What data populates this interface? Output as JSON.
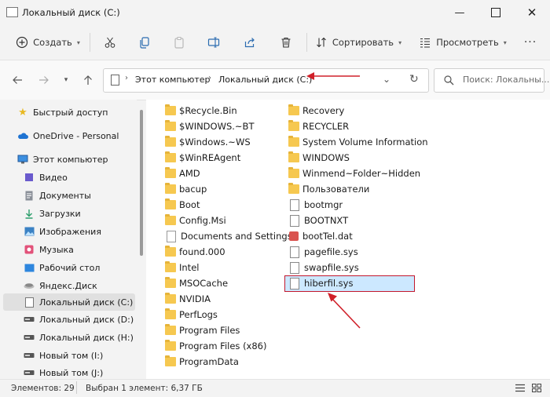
{
  "window": {
    "title": "Локальный диск (C:)"
  },
  "toolbar": {
    "create_label": "Создать",
    "sort_label": "Сортировать",
    "view_label": "Просмотреть"
  },
  "address": {
    "path": [
      "Этот компьютер",
      "Локальный диск (C:)"
    ]
  },
  "search": {
    "placeholder": "Поиск: Локальны..."
  },
  "sidebar": {
    "items": [
      {
        "label": "Быстрый доступ",
        "icon": "star-icon"
      },
      {
        "label": "OneDrive - Personal",
        "icon": "cloud-icon"
      },
      {
        "label": "Этот компьютер",
        "icon": "computer-icon"
      },
      {
        "label": "Видео",
        "icon": "video-icon"
      },
      {
        "label": "Документы",
        "icon": "documents-icon"
      },
      {
        "label": "Загрузки",
        "icon": "downloads-icon"
      },
      {
        "label": "Изображения",
        "icon": "pictures-icon"
      },
      {
        "label": "Музыка",
        "icon": "music-icon"
      },
      {
        "label": "Рабочий стол",
        "icon": "desktop-icon"
      },
      {
        "label": "Яндекс.Диск",
        "icon": "yandex-disk-icon"
      },
      {
        "label": "Локальный диск (C:)",
        "icon": "drive-icon",
        "selected": true
      },
      {
        "label": "Локальный диск (D:)",
        "icon": "drive-icon"
      },
      {
        "label": "Локальный диск (H:)",
        "icon": "drive-icon"
      },
      {
        "label": "Новый том (I:)",
        "icon": "drive-icon"
      },
      {
        "label": "Новый том (J:)",
        "icon": "drive-icon"
      }
    ]
  },
  "files": {
    "col1": [
      {
        "name": "$Recycle.Bin",
        "type": "folder"
      },
      {
        "name": "$WINDOWS.~BT",
        "type": "folder"
      },
      {
        "name": "$Windows.~WS",
        "type": "folder"
      },
      {
        "name": "$WinREAgent",
        "type": "folder"
      },
      {
        "name": "AMD",
        "type": "folder"
      },
      {
        "name": "bacup",
        "type": "folder"
      },
      {
        "name": "Boot",
        "type": "folder"
      },
      {
        "name": "Config.Msi",
        "type": "folder"
      },
      {
        "name": "Documents and Settings",
        "type": "shortcut"
      },
      {
        "name": "found.000",
        "type": "folder"
      },
      {
        "name": "Intel",
        "type": "folder"
      },
      {
        "name": "MSOCache",
        "type": "folder"
      },
      {
        "name": "NVIDIA",
        "type": "folder"
      },
      {
        "name": "PerfLogs",
        "type": "folder"
      },
      {
        "name": "Program Files",
        "type": "folder"
      },
      {
        "name": "Program Files (x86)",
        "type": "folder"
      },
      {
        "name": "ProgramData",
        "type": "folder"
      }
    ],
    "col2": [
      {
        "name": "Recovery",
        "type": "folder"
      },
      {
        "name": "RECYCLER",
        "type": "folder"
      },
      {
        "name": "System Volume Information",
        "type": "folder"
      },
      {
        "name": "WINDOWS",
        "type": "folder"
      },
      {
        "name": "Winmend~Folder~Hidden",
        "type": "folder"
      },
      {
        "name": "Пользователи",
        "type": "folder"
      },
      {
        "name": "bootmgr",
        "type": "file"
      },
      {
        "name": "BOOTNXT",
        "type": "file"
      },
      {
        "name": "bootTel.dat",
        "type": "dat"
      },
      {
        "name": "pagefile.sys",
        "type": "file"
      },
      {
        "name": "swapfile.sys",
        "type": "file"
      },
      {
        "name": "hiberfil.sys",
        "type": "file",
        "selected": true
      }
    ]
  },
  "status": {
    "items_count": "Элементов: 29",
    "selected": "Выбран 1 элемент: 6,37 ГБ"
  },
  "colors": {
    "accent": "#c2182d",
    "selection": "#cce8ff",
    "folder": "#f6c850"
  }
}
